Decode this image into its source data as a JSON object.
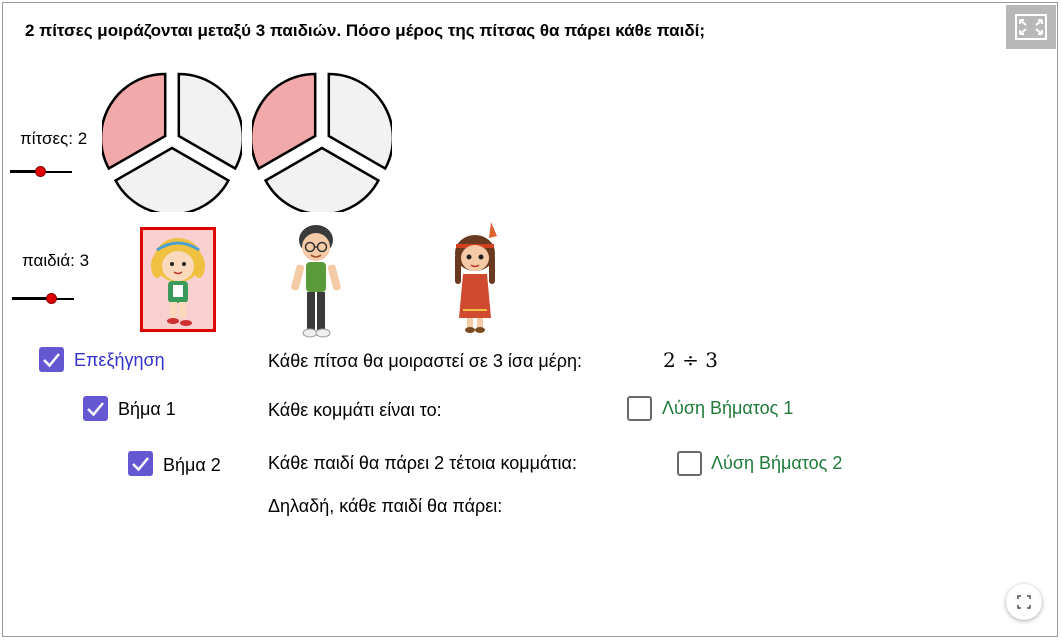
{
  "question": "2 πίτσες μοιράζονται μεταξύ 3 παιδιών. Πόσο μέρος της πίτσας θα πάρει κάθε παιδί;",
  "pizzas_slider": {
    "label": "πίτσες: 2",
    "value": 2
  },
  "kids_slider": {
    "label": "παιδιά: 3",
    "value": 3
  },
  "pizzas": {
    "count": 2,
    "slices_each": 3,
    "highlighted_per_pizza": 1,
    "highlight_color": "#f2a9a9",
    "plain_color": "#f2f2f2"
  },
  "kids": [
    {
      "name": "girl-kid",
      "selected": true
    },
    {
      "name": "boy-kid",
      "selected": false
    },
    {
      "name": "native-girl-kid",
      "selected": false
    }
  ],
  "checkboxes": {
    "explanation": {
      "label": "Επεξήγηση",
      "checked": true
    },
    "step1": {
      "label": "Βήμα 1",
      "checked": true
    },
    "step2": {
      "label": "Βήμα 2",
      "checked": true
    },
    "solution1": {
      "label": "Λύση Βήματος 1",
      "checked": false
    },
    "solution2": {
      "label": "Λύση Βήματος 2",
      "checked": false
    }
  },
  "lines": {
    "line1": "Κάθε πίτσα θα μοιραστεί σε 3 ίσα μέρη:",
    "line1_expr": "2 ÷ 3",
    "line2": "Κάθε κομμάτι είναι  το:",
    "line3": "Κάθε παιδί θα πάρει 2 τέτοια κομμάτια:",
    "line4": "Δηλαδή, κάθε παιδί θα πάρει:"
  },
  "colors": {
    "checkbox_accent": "#6557d2",
    "explanation_text": "#3333cc",
    "solution_text": "#1f7a3a",
    "slider_knob": "#e00000",
    "selected_kid_border": "#e00000"
  }
}
